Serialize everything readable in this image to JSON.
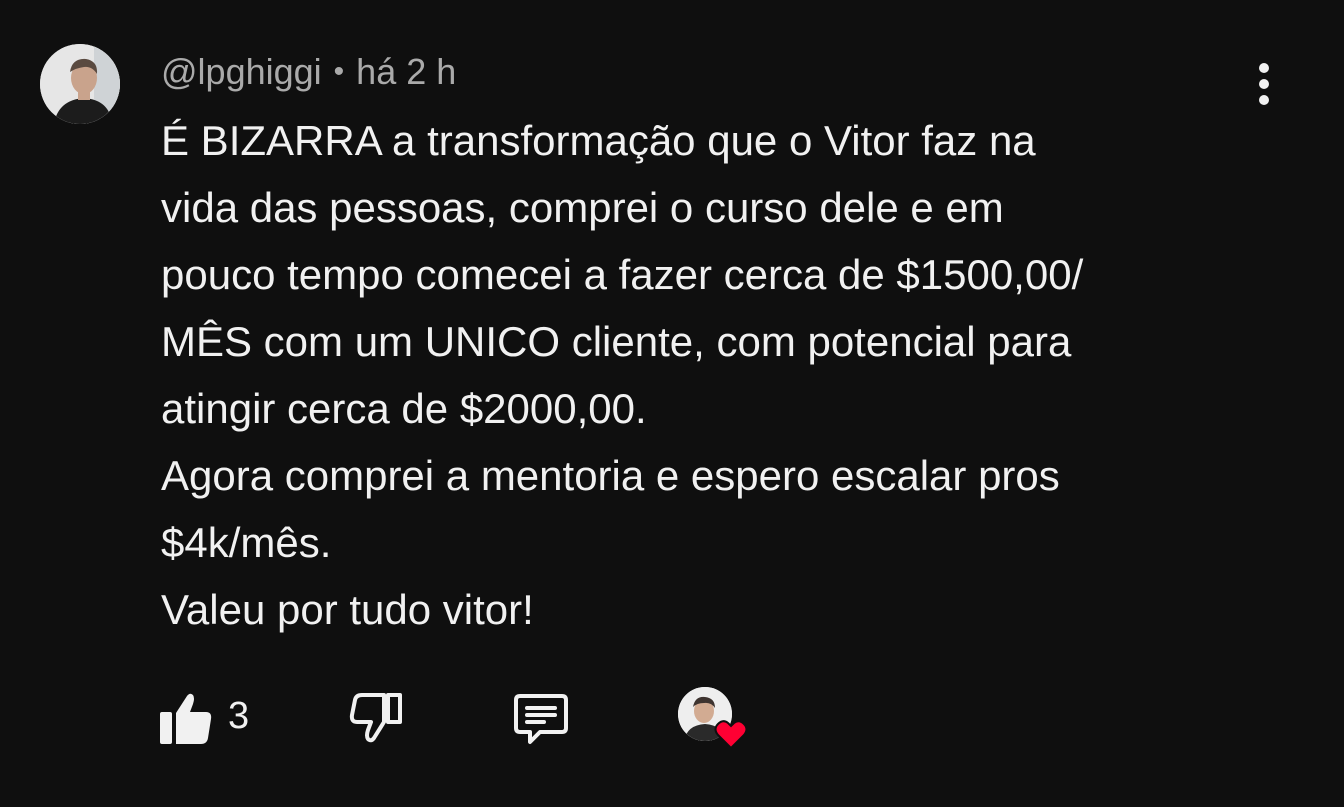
{
  "comment": {
    "author": "@lpghiggi",
    "separator": "•",
    "timestamp": "há 2 h",
    "avatar_icon": "user-avatar-photo",
    "menu_icon": "more-vert-icon",
    "body_lines": [
      "É BIZARRA a transformação que o Vitor faz na",
      "vida das pessoas, comprei o curso dele e em",
      "pouco tempo comecei a fazer cerca de $1500,00/",
      "MÊS com um UNICO cliente, com potencial para",
      "atingir cerca de $2000,00.",
      "Agora comprei a mentoria e espero escalar pros",
      "$4k/mês.",
      "Valeu por tudo vitor!"
    ]
  },
  "actions": {
    "like_icon": "thumbs-up-filled-icon",
    "like_count": "3",
    "dislike_icon": "thumbs-down-outline-icon",
    "reply_icon": "comment-reply-icon",
    "creator_heart_icon": "heart-icon"
  },
  "colors": {
    "background": "#0f0f0f",
    "text_primary": "#f1f1f1",
    "text_secondary": "#aaaaaa",
    "heart": "#ff0033"
  }
}
